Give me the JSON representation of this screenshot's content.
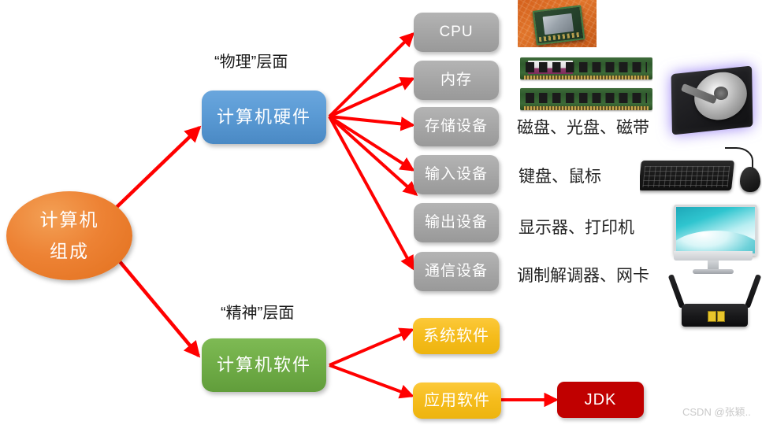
{
  "diagram": {
    "title": "计算机组成",
    "root": {
      "line1": "计算机",
      "line2": "组成"
    },
    "layer_labels": {
      "physical": "“物理”层面",
      "spiritual": "“精神”层面"
    },
    "branches": {
      "hardware": "计算机硬件",
      "software": "计算机软件"
    },
    "hardware_items": [
      {
        "label": "CPU",
        "examples": ""
      },
      {
        "label": "内存",
        "examples": ""
      },
      {
        "label": "存储设备",
        "examples": "磁盘、光盘、磁带"
      },
      {
        "label": "输入设备",
        "examples": "键盘、鼠标"
      },
      {
        "label": "输出设备",
        "examples": "显示器、打印机"
      },
      {
        "label": "通信设备",
        "examples": "调制解调器、网卡"
      }
    ],
    "software_items": [
      {
        "label": "系统软件"
      },
      {
        "label": "应用软件"
      }
    ],
    "jdk": "JDK",
    "images": [
      {
        "name": "cpu-chip-photo",
        "alt": "CPU 芯片"
      },
      {
        "name": "ram-modules-photo",
        "alt": "内存条"
      },
      {
        "name": "hard-disk-photo",
        "alt": "硬盘"
      },
      {
        "name": "keyboard-mouse-photo",
        "alt": "键盘鼠标"
      },
      {
        "name": "imac-monitor-photo",
        "alt": "显示器"
      },
      {
        "name": "wifi-router-photo",
        "alt": "路由器"
      }
    ],
    "colors": {
      "arrow": "#ff0000",
      "root": "#ed8234",
      "hardware": "#5b9bd5",
      "software": "#70ad47",
      "component": "#a6a6a6",
      "software_item": "#f5bc1c",
      "jdk": "#c00000"
    },
    "watermark": "CSDN @张颖.."
  }
}
